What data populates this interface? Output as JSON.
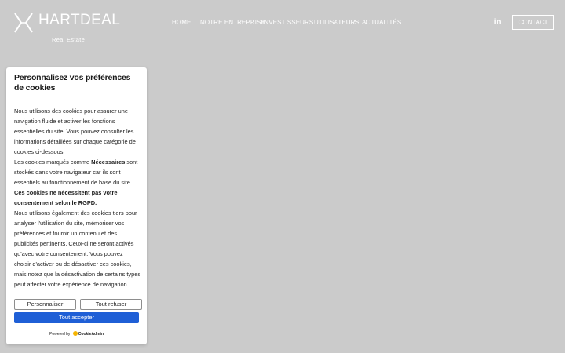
{
  "header": {
    "logo": {
      "title": "HARTDEAL",
      "subtitle": "Real Estate"
    },
    "nav": [
      {
        "label": "HOME",
        "active": true
      },
      {
        "label": "NOTRE ENTREPRISE",
        "active": false
      },
      {
        "label": "INVESTISSEURS",
        "active": false
      },
      {
        "label": "UTILISATEURS",
        "active": false
      },
      {
        "label": "ACTUALITÉS",
        "active": false
      }
    ],
    "social": {
      "linkedin_glyph": "in",
      "icon": "linkedin-icon"
    },
    "contact_label": "CONTACT"
  },
  "cookie_dialog": {
    "title": "Personnalisez vos préférences de cookies",
    "p1": "Nous utilisons des cookies pour assurer une navigation fluide et activer les fonctions essentielles du site. Vous pouvez consulter les informations détaillées sur chaque catégorie de cookies ci-dessous.",
    "p2_before": "Les cookies marqués comme ",
    "p2_bold": "Nécessaires",
    "p2_after": " sont stockés dans votre navigateur car ils sont essentiels au fonctionnement de base du site.",
    "p3_bold": "Ces cookies ne nécessitent pas votre consentement selon le RGPD.",
    "p4": "Nous utilisons également des cookies tiers pour analyser l'utilisation du site, mémoriser vos préférences et fournir un contenu et des publicités pertinents. Ceux-ci ne seront activés qu'avec votre consentement. Vous pouvez choisir d'activer ou de désactiver ces cookies, mais notez que la désactivation de certains types peut affecter votre expérience de navigation.",
    "buttons": {
      "customize": "Personnaliser",
      "refuse": "Tout refuser",
      "accept": "Tout accepter"
    },
    "powered_by": "Powered by",
    "powered_brand": "CookieAdmin"
  },
  "colors": {
    "background": "#cbcbcb",
    "accent": "#1f5fd6",
    "text_light": "#ffffff"
  }
}
